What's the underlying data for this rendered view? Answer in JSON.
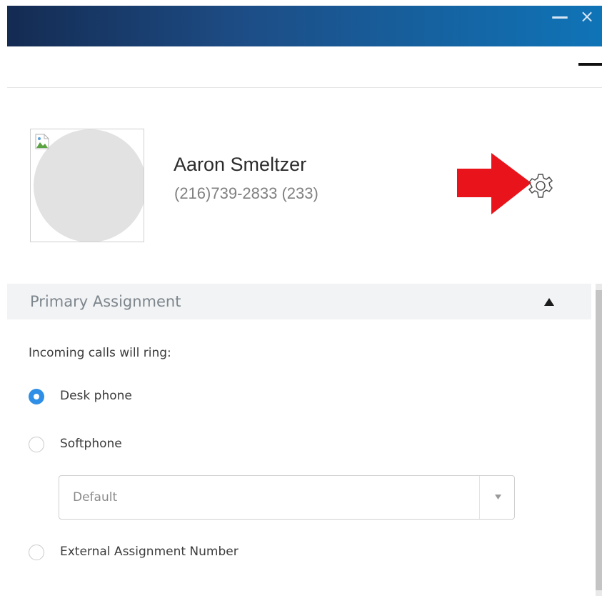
{
  "window": {
    "minimize_glyph": "—",
    "close_glyph": "×",
    "title_bar_colors": [
      "#142b52",
      "#1d4d86",
      "#0f74b7"
    ]
  },
  "toolbar": {
    "menu_icon": "hamburger-icon"
  },
  "profile": {
    "name": "Aaron Smeltzer",
    "phone": "(216)739-2833 (233)",
    "avatar_icon": "broken-image-icon",
    "settings_icon": "gear-icon",
    "annotation_icon": "red-arrow-icon",
    "annotation_color": "#e8131b"
  },
  "section": {
    "title": "Primary Assignment",
    "toggle_icon": "triangle-up-icon",
    "ring_label": "Incoming calls will ring:",
    "options": [
      {
        "label": "Desk phone",
        "checked": true
      },
      {
        "label": "Softphone",
        "checked": false
      },
      {
        "label": "External Assignment Number",
        "checked": false
      }
    ],
    "softphone_select": {
      "value": "Default",
      "arrow_icon": "chevron-down-icon"
    }
  },
  "colors": {
    "accent": "#2f8ee5",
    "header_bg": "#f2f3f4",
    "section_title": "#7d868d"
  }
}
